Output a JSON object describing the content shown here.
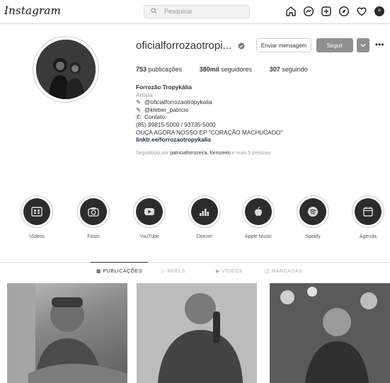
{
  "nav": {
    "logo": "Instagram",
    "search_placeholder": "Pesquisar",
    "icons": [
      "home-icon",
      "messenger-icon",
      "new-post-icon",
      "explore-icon",
      "heart-icon",
      "profile-avatar"
    ]
  },
  "profile": {
    "username": "oficialforrozaotropi...",
    "message_label": "Enviar mensagem",
    "follow_label": "Seguir",
    "stats": {
      "posts_count": "753",
      "posts_label": "publicações",
      "followers_count": "380mil",
      "followers_label": "seguidores",
      "following_count": "307",
      "following_label": "seguindo"
    },
    "bio": {
      "name": "Forrozão Tropykália",
      "category": "Artista",
      "lines": [
        "@oficialforrozaotropykalia",
        "@kleber_patricio",
        "Contato:",
        "(85) 99815-5000 / 93735-5000",
        "OUÇA AGORA NOSSO EP \"CORAÇÃO MACHUCADO\"",
        "linktr.ee/forrozaotropykalia"
      ],
      "followed_by_prefix": "Seguido(a) por",
      "followed_by_names": "patriciaforrozeira, forrozeiro",
      "followed_by_suffix": "e mais 5 pessoas"
    }
  },
  "highlights": [
    {
      "label": "Vídeos",
      "icon": "video-icon"
    },
    {
      "label": "Fotos",
      "icon": "camera-icon"
    },
    {
      "label": "YouTube",
      "icon": "youtube-icon"
    },
    {
      "label": "Deezer",
      "icon": "deezer-icon"
    },
    {
      "label": "Apple Music",
      "icon": "apple-icon"
    },
    {
      "label": "Spotify",
      "icon": "spotify-icon"
    },
    {
      "label": "Agenda",
      "icon": "calendar-icon"
    }
  ],
  "tabs": [
    {
      "label": "PUBLICAÇÕES",
      "active": true
    },
    {
      "label": "REELS",
      "active": false
    },
    {
      "label": "VÍDEOS",
      "active": false
    },
    {
      "label": "MARCADAS",
      "active": false
    }
  ],
  "colors": {
    "follow_button": "#8f8f8f",
    "highlight_disc": "#2c2c2c"
  }
}
